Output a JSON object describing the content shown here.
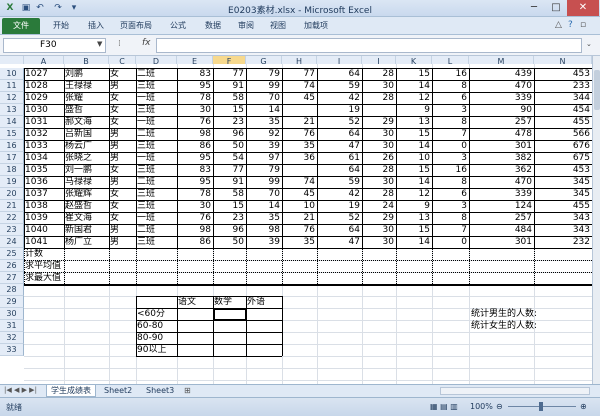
{
  "window": {
    "title": "E0203素材.xlsx - Microsoft Excel",
    "controls": [
      "─",
      "□",
      "✕"
    ]
  },
  "ribbon": {
    "file": "文件",
    "tabs": [
      "开始",
      "插入",
      "页面布局",
      "公式",
      "数据",
      "审阅",
      "视图",
      "加载项"
    ]
  },
  "formula_bar": {
    "name_box": "F30",
    "fx": "fx",
    "formula": ""
  },
  "columns": [
    "A",
    "B",
    "C",
    "D",
    "E",
    "F",
    "G",
    "H",
    "I",
    "J",
    "K",
    "L",
    "M",
    "N"
  ],
  "rows": [
    {
      "n": "10",
      "id": "1027",
      "name": "刘鹏",
      "sex": "女",
      "class": "二班",
      "e": "83",
      "f": "77",
      "g": "79",
      "h": "77",
      "i": "64",
      "j": "28",
      "k": "15",
      "l": "16",
      "m": "439",
      "nn": "453"
    },
    {
      "n": "11",
      "id": "1028",
      "name": "王禄禄",
      "sex": "男",
      "class": "三班",
      "e": "95",
      "f": "91",
      "g": "99",
      "h": "74",
      "i": "59",
      "j": "30",
      "k": "14",
      "l": "8",
      "m": "470",
      "nn": "233"
    },
    {
      "n": "12",
      "id": "1029",
      "name": "张耀",
      "sex": "女",
      "class": "一班",
      "e": "78",
      "f": "58",
      "g": "70",
      "h": "45",
      "i": "42",
      "j": "28",
      "k": "12",
      "l": "6",
      "m": "339",
      "nn": "344"
    },
    {
      "n": "13",
      "id": "1030",
      "name": "盛哲",
      "sex": "女",
      "class": "三班",
      "e": "30",
      "f": "15",
      "g": "14",
      "h": "",
      "i": "19",
      "j": "",
      "k": "9",
      "l": "3",
      "m": "90",
      "nn": "454"
    },
    {
      "n": "14",
      "id": "1031",
      "name": "郝文海",
      "sex": "女",
      "class": "一班",
      "e": "76",
      "f": "23",
      "g": "35",
      "h": "21",
      "i": "52",
      "j": "29",
      "k": "13",
      "l": "8",
      "m": "257",
      "nn": "455"
    },
    {
      "n": "15",
      "id": "1032",
      "name": "吕新国",
      "sex": "男",
      "class": "二班",
      "e": "98",
      "f": "96",
      "g": "92",
      "h": "76",
      "i": "64",
      "j": "30",
      "k": "15",
      "l": "7",
      "m": "478",
      "nn": "566"
    },
    {
      "n": "16",
      "id": "1033",
      "name": "杨云广",
      "sex": "男",
      "class": "三班",
      "e": "86",
      "f": "50",
      "g": "39",
      "h": "35",
      "i": "47",
      "j": "30",
      "k": "14",
      "l": "0",
      "m": "301",
      "nn": "676"
    },
    {
      "n": "17",
      "id": "1034",
      "name": "张晓之",
      "sex": "男",
      "class": "一班",
      "e": "95",
      "f": "54",
      "g": "97",
      "h": "36",
      "i": "61",
      "j": "26",
      "k": "10",
      "l": "3",
      "m": "382",
      "nn": "675"
    },
    {
      "n": "18",
      "id": "1035",
      "name": "刘一鹏",
      "sex": "女",
      "class": "三班",
      "e": "83",
      "f": "77",
      "g": "79",
      "h": "",
      "i": "64",
      "j": "28",
      "k": "15",
      "l": "16",
      "m": "362",
      "nn": "453"
    },
    {
      "n": "19",
      "id": "1036",
      "name": "马禄禄",
      "sex": "男",
      "class": "二班",
      "e": "95",
      "f": "91",
      "g": "99",
      "h": "74",
      "i": "59",
      "j": "30",
      "k": "14",
      "l": "8",
      "m": "470",
      "nn": "345"
    },
    {
      "n": "20",
      "id": "1037",
      "name": "张耀辉",
      "sex": "女",
      "class": "三班",
      "e": "78",
      "f": "58",
      "g": "70",
      "h": "45",
      "i": "42",
      "j": "28",
      "k": "12",
      "l": "6",
      "m": "339",
      "nn": "345"
    },
    {
      "n": "21",
      "id": "1038",
      "name": "赵盛哲",
      "sex": "女",
      "class": "三班",
      "e": "30",
      "f": "15",
      "g": "14",
      "h": "10",
      "i": "19",
      "j": "24",
      "k": "9",
      "l": "3",
      "m": "124",
      "nn": "455"
    },
    {
      "n": "22",
      "id": "1039",
      "name": "崔文海",
      "sex": "女",
      "class": "一班",
      "e": "76",
      "f": "23",
      "g": "35",
      "h": "21",
      "i": "52",
      "j": "29",
      "k": "13",
      "l": "8",
      "m": "257",
      "nn": "343"
    },
    {
      "n": "23",
      "id": "1040",
      "name": "新国君",
      "sex": "男",
      "class": "二班",
      "e": "98",
      "f": "96",
      "g": "98",
      "h": "76",
      "i": "64",
      "j": "30",
      "k": "15",
      "l": "7",
      "m": "484",
      "nn": "343"
    },
    {
      "n": "24",
      "id": "1041",
      "name": "杨广立",
      "sex": "男",
      "class": "三班",
      "e": "86",
      "f": "50",
      "g": "39",
      "h": "35",
      "i": "47",
      "j": "30",
      "k": "14",
      "l": "0",
      "m": "301",
      "nn": "232"
    }
  ],
  "summary_rows": [
    {
      "n": "25",
      "label": "计数"
    },
    {
      "n": "26",
      "label": "求平均值"
    },
    {
      "n": "27",
      "label": "求最大值"
    }
  ],
  "blank_rows": [
    "28",
    "29",
    "30",
    "31",
    "32",
    "33"
  ],
  "stats_table": {
    "headers": [
      "语文",
      "数学",
      "外语"
    ],
    "bands": [
      "<60分",
      "60-80",
      "80-90",
      "90以上"
    ]
  },
  "notes": [
    "统计男生的人数:",
    "统计女生的人数:"
  ],
  "sheets": [
    {
      "label": "学生成绩表",
      "active": true
    },
    {
      "label": "Sheet2",
      "active": false
    },
    {
      "label": "Sheet3",
      "active": false
    }
  ],
  "status": {
    "ready": "就绪",
    "zoom": "100%"
  }
}
